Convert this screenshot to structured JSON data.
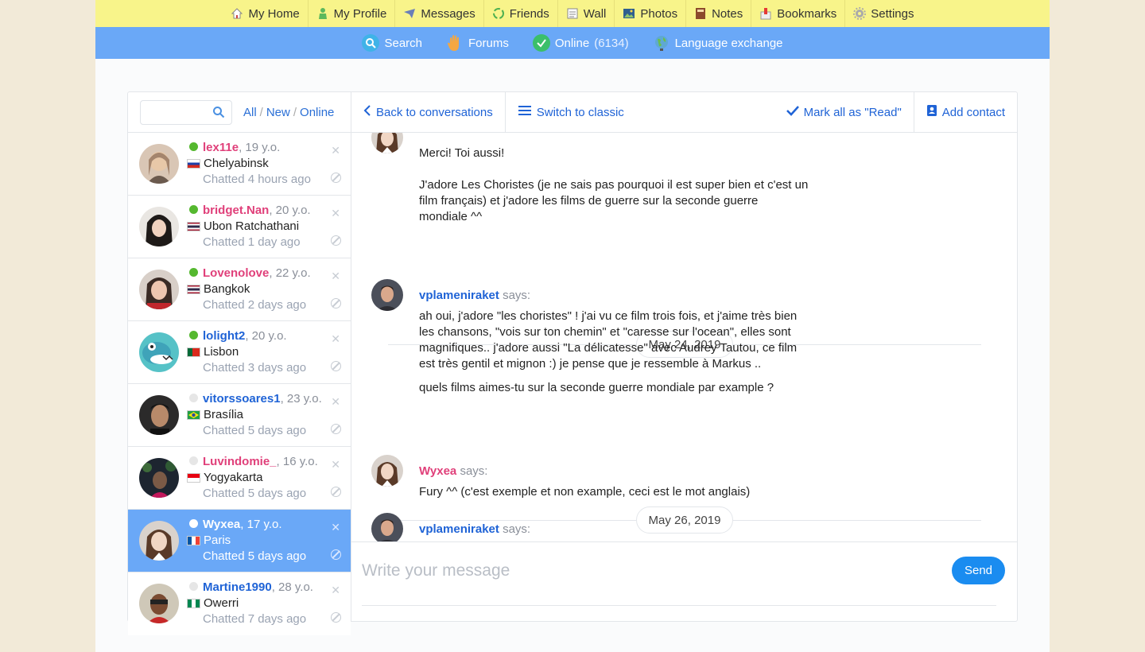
{
  "topnav": {
    "items": [
      {
        "label": "My Home",
        "icon": "home-icon"
      },
      {
        "label": "My Profile",
        "icon": "profile-icon"
      },
      {
        "label": "Messages",
        "icon": "messages-icon"
      },
      {
        "label": "Friends",
        "icon": "friends-icon"
      },
      {
        "label": "Wall",
        "icon": "wall-icon"
      },
      {
        "label": "Photos",
        "icon": "photos-icon"
      },
      {
        "label": "Notes",
        "icon": "notes-icon"
      },
      {
        "label": "Bookmarks",
        "icon": "bookmarks-icon"
      },
      {
        "label": "Settings",
        "icon": "settings-icon"
      }
    ]
  },
  "subnav": {
    "search": "Search",
    "forums": "Forums",
    "online": "Online",
    "online_count": "(6134)",
    "language_exchange": "Language exchange"
  },
  "sidebar": {
    "search_placeholder": "",
    "filter_all": "All",
    "filter_new": "New",
    "filter_online": "Online",
    "filter_sep": "/",
    "contacts": [
      {
        "name": "lex11e",
        "age": ", 19 y.o.",
        "location": "Chelyabinsk",
        "time": "Chatted 4 hours ago",
        "online": true,
        "gender": "f",
        "flag": "russia"
      },
      {
        "name": "bridget.Nan",
        "age": ", 20 y.o.",
        "location": "Ubon Ratchathani",
        "time": "Chatted 1 day ago",
        "online": true,
        "gender": "f",
        "flag": "thailand"
      },
      {
        "name": "Lovenolove",
        "age": ", 22 y.o.",
        "location": "Bangkok",
        "time": "Chatted 2 days ago",
        "online": true,
        "gender": "f",
        "flag": "thailand"
      },
      {
        "name": "lolight2",
        "age": ", 20 y.o.",
        "location": "Lisbon",
        "time": "Chatted 3 days ago",
        "online": true,
        "gender": "m",
        "flag": "portugal"
      },
      {
        "name": "vitorssoares1",
        "age": ", 23 y.o.",
        "location": "Brasília",
        "time": "Chatted 5 days ago",
        "online": false,
        "gender": "m",
        "flag": "brazil"
      },
      {
        "name": "Luvindomie_",
        "age": ", 16 y.o.",
        "location": "Yogyakarta",
        "time": "Chatted 5 days ago",
        "online": false,
        "gender": "f",
        "flag": "indonesia"
      },
      {
        "name": "Wyxea",
        "age": ", 17 y.o.",
        "location": "Paris",
        "time": "Chatted 5 days ago",
        "online": false,
        "gender": "f",
        "flag": "france",
        "active": true
      },
      {
        "name": "Martine1990",
        "age": ", 28 y.o.",
        "location": "Owerri",
        "time": "Chatted 7 days ago",
        "online": false,
        "gender": "m",
        "flag": "nigeria"
      }
    ]
  },
  "conversation": {
    "back": "Back to conversations",
    "switch": "Switch to classic",
    "mark_read": "Mark all as \"Read\"",
    "add_contact": "Add contact",
    "says": "says:",
    "messages": [
      {
        "author": "",
        "text": "Merci! Toi aussi!\n\nJ'adore Les Choristes (je ne sais pas pourquoi il est super bien et c'est un film français) et j'adore les films de guerre sur la seconde guerre mondiale ^^"
      },
      {
        "date": "May 24, 2019"
      },
      {
        "author": "vplameniraket",
        "text": "ah oui, j'adore \"les choristes\" ! j'ai vu ce film trois fois, et j'aime très bien les chansons, \"vois sur ton chemin\" et \"caresse sur l'ocean\", elles sont magnifiques.. j'adore aussi \"La délicatesse\" avec Audrey Tautou, ce film est très gentil et mignon :) je pense que je ressemble à Markus ..",
        "text2": "quels films aimes-tu sur la seconde guerre mondiale par example ?"
      },
      {
        "date": "May 26, 2019"
      },
      {
        "author": "Wyxea",
        "text": "Fury ^^ (c'est exemple et non example, ceci est le mot anglais)"
      },
      {
        "author": "vplameniraket",
        "text": ""
      }
    ],
    "composer_placeholder": "Write your message",
    "send": "Send"
  },
  "colors": {
    "topnav_bg": "#f8f48a",
    "subnav_bg": "#6aa8f7",
    "female_name": "#e0407a",
    "male_name": "#1f63d6",
    "online_dot": "#55b82f",
    "send_button": "#1a8cf0"
  }
}
